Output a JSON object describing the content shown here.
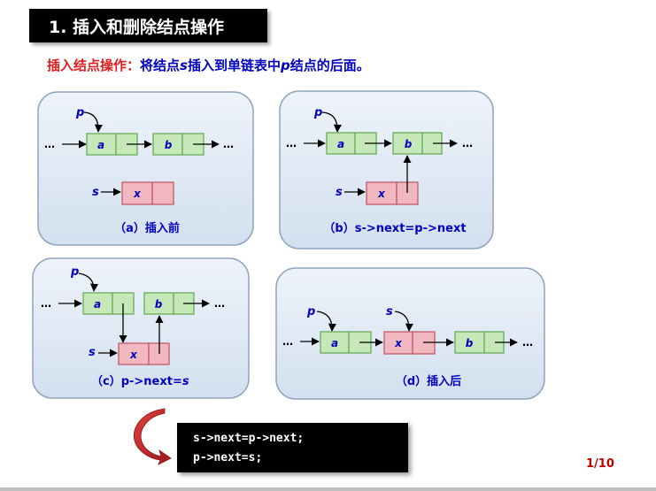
{
  "title": "1. 插入和删除结点操作",
  "subtitle": {
    "label": "插入结点操作：",
    "part1": "将结点",
    "s": "s",
    "part2": "插入到单链表中",
    "p": "p",
    "part3": "结点的后面。"
  },
  "ellipsis": "…",
  "panels": {
    "a": {
      "caption": "（a）插入前",
      "p": "p",
      "s": "s",
      "node_a": "a",
      "node_b": "b",
      "node_x": "x"
    },
    "b": {
      "caption": "（b）s->next=p->next",
      "p": "p",
      "s": "s",
      "node_a": "a",
      "node_b": "b",
      "node_x": "x"
    },
    "c": {
      "caption_prefix": "（c）p->next=",
      "caption_s": "s",
      "p": "p",
      "s": "s",
      "node_a": "a",
      "node_b": "b",
      "node_x": "x"
    },
    "d": {
      "caption": "（d）插入后",
      "p": "p",
      "s": "s",
      "node_a": "a",
      "node_x": "x",
      "node_b": "b"
    }
  },
  "code": {
    "line1": "s->next=p->next;",
    "line2": "p->next=s;"
  },
  "page_number": "1/10",
  "colors": {
    "green_node": "#c6e8b8",
    "green_stroke": "#5fa84f",
    "pink_node": "#f2b8c0",
    "pink_stroke": "#c05060",
    "panel_fill": "#dde8f4",
    "panel_stroke": "#8fa4bd",
    "label_blue": "#0000c0",
    "title_red": "#e02020",
    "curved_arrow": "#c0282a"
  }
}
